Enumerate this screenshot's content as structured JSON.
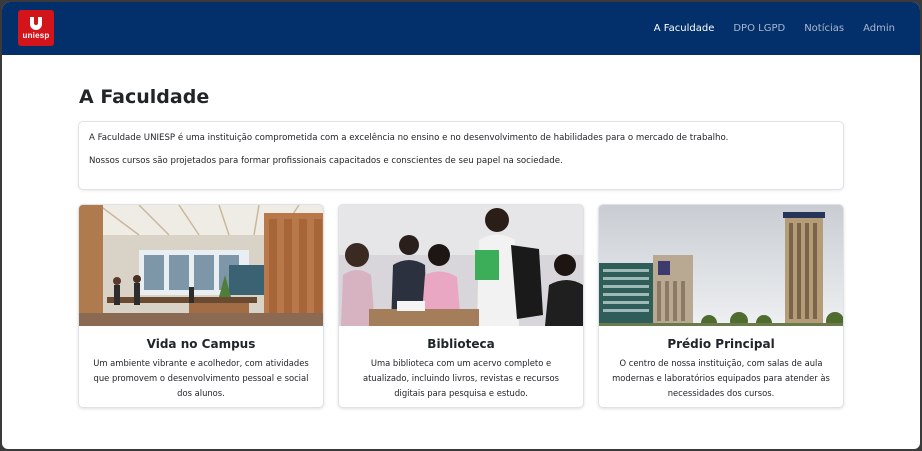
{
  "brand": {
    "logo_text": "uniesp",
    "logo_color": "#d4141b"
  },
  "colors": {
    "navbar": "#032f6b",
    "text": "#212529"
  },
  "nav": {
    "links": [
      {
        "label": "A Faculdade",
        "active": true
      },
      {
        "label": "DPO LGPD",
        "active": false
      },
      {
        "label": "Notícias",
        "active": false
      },
      {
        "label": "Admin",
        "active": false
      }
    ]
  },
  "page": {
    "title": "A Faculdade",
    "intro": [
      "A Faculdade UNIESP é uma instituição comprometida com a excelência no ensino e no desenvolvimento de habilidades para o mercado de trabalho.",
      "Nossos cursos são projetados para formar profissionais capacitados e conscientes de seu papel na sociedade."
    ]
  },
  "cards": [
    {
      "title": "Vida no Campus",
      "text": "Um ambiente vibrante e acolhedor, com atividades que promovem o desenvolvimento pessoal e social dos alunos.",
      "image": "campus-office-photo"
    },
    {
      "title": "Biblioteca",
      "text": "Uma biblioteca com um acervo completo e atualizado, incluindo livros, revistas e recursos digitais para pesquisa e estudo.",
      "image": "students-studying-photo"
    },
    {
      "title": "Prédio Principal",
      "text": "O centro de nossa instituição, com salas de aula modernas e laboratórios equipados para atender às necessidades dos cursos.",
      "image": "main-building-photo"
    }
  ]
}
